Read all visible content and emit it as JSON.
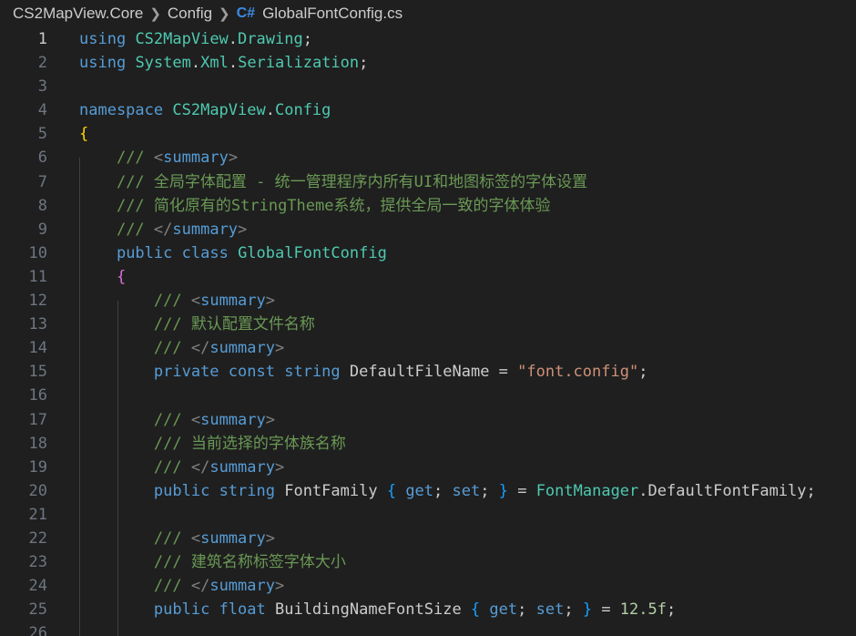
{
  "breadcrumb": {
    "project": "CS2MapView.Core",
    "folder": "Config",
    "file_icon": "C#",
    "file": "GlobalFontConfig.cs"
  },
  "active_line": 1,
  "lines": [
    {
      "n": "1",
      "tokens": [
        [
          "kw",
          "using"
        ],
        [
          "id",
          " "
        ],
        [
          "ty",
          "CS2MapView"
        ],
        [
          "id",
          "."
        ],
        [
          "ty",
          "Drawing"
        ],
        [
          "id",
          ";"
        ]
      ]
    },
    {
      "n": "2",
      "tokens": [
        [
          "kw",
          "using"
        ],
        [
          "id",
          " "
        ],
        [
          "ty",
          "System"
        ],
        [
          "id",
          "."
        ],
        [
          "ty",
          "Xml"
        ],
        [
          "id",
          "."
        ],
        [
          "ty",
          "Serialization"
        ],
        [
          "id",
          ";"
        ]
      ]
    },
    {
      "n": "3",
      "tokens": []
    },
    {
      "n": "4",
      "tokens": [
        [
          "kw",
          "namespace"
        ],
        [
          "id",
          " "
        ],
        [
          "ty",
          "CS2MapView"
        ],
        [
          "id",
          "."
        ],
        [
          "ty",
          "Config"
        ]
      ]
    },
    {
      "n": "5",
      "tokens": [
        [
          "br1",
          "{"
        ]
      ]
    },
    {
      "n": "6",
      "tokens": [
        [
          "id",
          "    "
        ],
        [
          "cm",
          "/// "
        ],
        [
          "sym",
          "<"
        ],
        [
          "cmtag",
          "summary"
        ],
        [
          "sym",
          ">"
        ]
      ]
    },
    {
      "n": "7",
      "tokens": [
        [
          "id",
          "    "
        ],
        [
          "cm",
          "/// 全局字体配置 - 统一管理程序内所有UI和地图标签的字体设置"
        ]
      ]
    },
    {
      "n": "8",
      "tokens": [
        [
          "id",
          "    "
        ],
        [
          "cm",
          "/// 简化原有的StringTheme系统，提供全局一致的字体体验"
        ]
      ]
    },
    {
      "n": "9",
      "tokens": [
        [
          "id",
          "    "
        ],
        [
          "cm",
          "/// "
        ],
        [
          "sym",
          "</"
        ],
        [
          "cmtag",
          "summary"
        ],
        [
          "sym",
          ">"
        ]
      ]
    },
    {
      "n": "10",
      "tokens": [
        [
          "id",
          "    "
        ],
        [
          "kw",
          "public"
        ],
        [
          "id",
          " "
        ],
        [
          "kw",
          "class"
        ],
        [
          "id",
          " "
        ],
        [
          "ty",
          "GlobalFontConfig"
        ]
      ]
    },
    {
      "n": "11",
      "tokens": [
        [
          "id",
          "    "
        ],
        [
          "br2",
          "{"
        ]
      ]
    },
    {
      "n": "12",
      "tokens": [
        [
          "id",
          "        "
        ],
        [
          "cm",
          "/// "
        ],
        [
          "sym",
          "<"
        ],
        [
          "cmtag",
          "summary"
        ],
        [
          "sym",
          ">"
        ]
      ]
    },
    {
      "n": "13",
      "tokens": [
        [
          "id",
          "        "
        ],
        [
          "cm",
          "/// 默认配置文件名称"
        ]
      ]
    },
    {
      "n": "14",
      "tokens": [
        [
          "id",
          "        "
        ],
        [
          "cm",
          "/// "
        ],
        [
          "sym",
          "</"
        ],
        [
          "cmtag",
          "summary"
        ],
        [
          "sym",
          ">"
        ]
      ]
    },
    {
      "n": "15",
      "tokens": [
        [
          "id",
          "        "
        ],
        [
          "kw",
          "private"
        ],
        [
          "id",
          " "
        ],
        [
          "kw",
          "const"
        ],
        [
          "id",
          " "
        ],
        [
          "kw",
          "string"
        ],
        [
          "id",
          " "
        ],
        [
          "id",
          "DefaultFileName = "
        ],
        [
          "st",
          "\"font.config\""
        ],
        [
          "id",
          ";"
        ]
      ]
    },
    {
      "n": "16",
      "tokens": []
    },
    {
      "n": "17",
      "tokens": [
        [
          "id",
          "        "
        ],
        [
          "cm",
          "/// "
        ],
        [
          "sym",
          "<"
        ],
        [
          "cmtag",
          "summary"
        ],
        [
          "sym",
          ">"
        ]
      ]
    },
    {
      "n": "18",
      "tokens": [
        [
          "id",
          "        "
        ],
        [
          "cm",
          "/// 当前选择的字体族名称"
        ]
      ]
    },
    {
      "n": "19",
      "tokens": [
        [
          "id",
          "        "
        ],
        [
          "cm",
          "/// "
        ],
        [
          "sym",
          "</"
        ],
        [
          "cmtag",
          "summary"
        ],
        [
          "sym",
          ">"
        ]
      ]
    },
    {
      "n": "20",
      "tokens": [
        [
          "id",
          "        "
        ],
        [
          "kw",
          "public"
        ],
        [
          "id",
          " "
        ],
        [
          "kw",
          "string"
        ],
        [
          "id",
          " FontFamily "
        ],
        [
          "br3",
          "{"
        ],
        [
          "id",
          " "
        ],
        [
          "kw",
          "get"
        ],
        [
          "id",
          "; "
        ],
        [
          "kw",
          "set"
        ],
        [
          "id",
          "; "
        ],
        [
          "br3",
          "}"
        ],
        [
          "id",
          " = "
        ],
        [
          "ty",
          "FontManager"
        ],
        [
          "id",
          ".DefaultFontFamily;"
        ]
      ]
    },
    {
      "n": "21",
      "tokens": []
    },
    {
      "n": "22",
      "tokens": [
        [
          "id",
          "        "
        ],
        [
          "cm",
          "/// "
        ],
        [
          "sym",
          "<"
        ],
        [
          "cmtag",
          "summary"
        ],
        [
          "sym",
          ">"
        ]
      ]
    },
    {
      "n": "23",
      "tokens": [
        [
          "id",
          "        "
        ],
        [
          "cm",
          "/// 建筑名称标签字体大小"
        ]
      ]
    },
    {
      "n": "24",
      "tokens": [
        [
          "id",
          "        "
        ],
        [
          "cm",
          "/// "
        ],
        [
          "sym",
          "</"
        ],
        [
          "cmtag",
          "summary"
        ],
        [
          "sym",
          ">"
        ]
      ]
    },
    {
      "n": "25",
      "tokens": [
        [
          "id",
          "        "
        ],
        [
          "kw",
          "public"
        ],
        [
          "id",
          " "
        ],
        [
          "kw",
          "float"
        ],
        [
          "id",
          " BuildingNameFontSize "
        ],
        [
          "br3",
          "{"
        ],
        [
          "id",
          " "
        ],
        [
          "kw",
          "get"
        ],
        [
          "id",
          "; "
        ],
        [
          "kw",
          "set"
        ],
        [
          "id",
          "; "
        ],
        [
          "br3",
          "}"
        ],
        [
          "id",
          " = "
        ],
        [
          "nm",
          "12.5f"
        ],
        [
          "id",
          ";"
        ]
      ]
    },
    {
      "n": "26",
      "tokens": []
    }
  ]
}
